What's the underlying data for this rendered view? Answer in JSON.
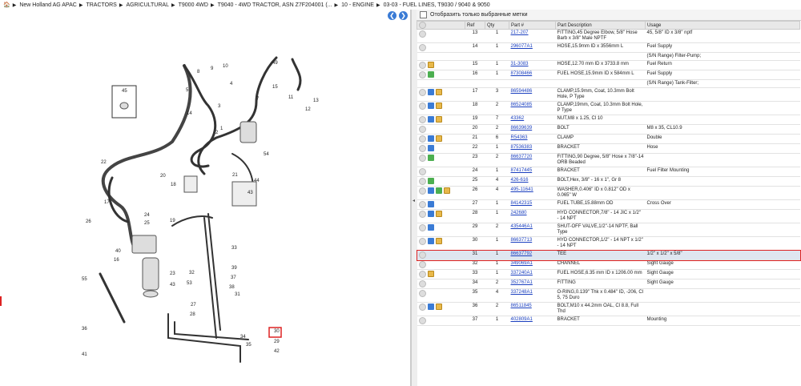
{
  "breadcrumbs": [
    "New Holland AG APAC",
    "TRACTORS",
    "AGRICULTURAL",
    "T9000 4WD",
    "T9040 - 4WD TRACTOR, ASN Z7F204001 (...",
    "10 - ENGINE",
    "03-03 - FUEL LINES, T9030 / 9040 & 9050"
  ],
  "filter": {
    "label": "Отобразить только выбранные метки"
  },
  "table": {
    "headers": {
      "ref": "Ref",
      "qty": "Qty",
      "part": "Part #",
      "desc": "Part Description",
      "usage": "Usage"
    },
    "rows": [
      {
        "ref": "13",
        "qty": "1",
        "part": "217-207",
        "desc": "FITTING,45 Degree Elbow, 5/8\" Hose Barb x 3/8\" Male NPTF",
        "usage": "45, 5/8\" ID x 3/8\" nptf",
        "icons": []
      },
      {
        "ref": "14",
        "qty": "1",
        "part": "296077A1",
        "desc": "HOSE,15.9mm ID x 3556mm L",
        "usage": "Fuel Supply",
        "icons": []
      },
      {
        "ref": "",
        "qty": "",
        "part": "",
        "desc": "",
        "usage": "(S/N Range) Filter-Pump;",
        "icons": []
      },
      {
        "ref": "15",
        "qty": "1",
        "part": "31-3083",
        "desc": "HOSE,12.70 mm ID x 3733.8 mm",
        "usage": "Fuel Return",
        "icons": [
          "bx"
        ]
      },
      {
        "ref": "16",
        "qty": "1",
        "part": "87308466",
        "desc": "FUEL HOSE,15.9mm ID x 584mm L",
        "usage": "Fuel Supply",
        "icons": [
          "gr"
        ]
      },
      {
        "ref": "",
        "qty": "",
        "part": "",
        "desc": "",
        "usage": "(S/N Range) Tank-Filter;",
        "icons": []
      },
      {
        "ref": "17",
        "qty": "3",
        "part": "86594486",
        "desc": "CLAMP,15.9mm, Coat, 10.3mm Bolt Hole, P Type",
        "usage": "",
        "icons": [
          "sw",
          "bx"
        ]
      },
      {
        "ref": "18",
        "qty": "2",
        "part": "86524085",
        "desc": "CLAMP,19mm, Coat, 10.3mm Bolt Hole, P Type",
        "usage": "",
        "icons": [
          "sw",
          "bx"
        ]
      },
      {
        "ref": "19",
        "qty": "7",
        "part": "43362",
        "desc": "NUT,M8 x 1.25, Cl 10",
        "usage": "",
        "icons": [
          "sw",
          "bx"
        ]
      },
      {
        "ref": "20",
        "qty": "2",
        "part": "86639639",
        "desc": "BOLT",
        "usage": "M8 x 35, CL10.9",
        "icons": []
      },
      {
        "ref": "21",
        "qty": "6",
        "part": "R54363",
        "desc": "CLAMP",
        "usage": "Double",
        "icons": [
          "sw",
          "bx"
        ]
      },
      {
        "ref": "22",
        "qty": "1",
        "part": "87536383",
        "desc": "BRACKET",
        "usage": "Hose",
        "icons": [
          "sw"
        ]
      },
      {
        "ref": "23",
        "qty": "2",
        "part": "86637720",
        "desc": "FITTING,90 Degree, 5/8\" Hose x 7/8\"-14 ORB Beaded",
        "usage": "",
        "icons": [
          "gr"
        ]
      },
      {
        "ref": "24",
        "qty": "1",
        "part": "87417445",
        "desc": "BRACKET",
        "usage": "Fuel Filter Mounting",
        "icons": []
      },
      {
        "ref": "25",
        "qty": "4",
        "part": "426-616",
        "desc": "BOLT,Hex, 3/8\" - 16 x 1\", Gr 8",
        "usage": "",
        "icons": [
          "gr"
        ]
      },
      {
        "ref": "26",
        "qty": "4",
        "part": "495-11641",
        "desc": "WASHER,0.406\" ID x 0.812\" OD x 0.065\" W",
        "usage": "",
        "icons": [
          "sw",
          "gr",
          "bx"
        ]
      },
      {
        "ref": "27",
        "qty": "1",
        "part": "84142315",
        "desc": "FUEL TUBE,15.88mm OD",
        "usage": "Cross Over",
        "icons": [
          "sw"
        ]
      },
      {
        "ref": "28",
        "qty": "1",
        "part": "242680",
        "desc": "HYD CONNECTOR,7/8\" - 14 JIC x 1/2\" - 14 NPT",
        "usage": "",
        "icons": [
          "sw",
          "bx"
        ]
      },
      {
        "ref": "29",
        "qty": "2",
        "part": "435446A1",
        "desc": "SHUT-OFF VALVE,1/2\"-14 NPTF, Ball Type",
        "usage": "",
        "icons": [
          "sw"
        ]
      },
      {
        "ref": "30",
        "qty": "1",
        "part": "86637713",
        "desc": "HYD CONNECTOR,1/2\" - 14 NPT x 1/2\" - 14 NPT",
        "usage": "",
        "icons": [
          "sw",
          "bx"
        ]
      },
      {
        "ref": "31",
        "qty": "1",
        "part": "86637792",
        "desc": "TEE",
        "usage": "1/2\" x 1/2\" x 5/8\"",
        "icons": [],
        "selected": true
      },
      {
        "ref": "32",
        "qty": "1",
        "part": "349069A1",
        "desc": "CHANNEL",
        "usage": "Sight Gauge",
        "icons": []
      },
      {
        "ref": "33",
        "qty": "1",
        "part": "337240A1",
        "desc": "FUEL HOSE,6.35 mm ID x 1206.00 mm",
        "usage": "Sight Gauge",
        "icons": [
          "bx"
        ]
      },
      {
        "ref": "34",
        "qty": "2",
        "part": "352767A1",
        "desc": "FITTING",
        "usage": "Sight Gauge",
        "icons": []
      },
      {
        "ref": "35",
        "qty": "4",
        "part": "337248A1",
        "desc": "O-RING,0.139\" Thk x 0.484\" ID, -206, Cl 5, 75 Duro",
        "usage": "",
        "icons": []
      },
      {
        "ref": "36",
        "qty": "2",
        "part": "86511845",
        "desc": "BOLT,M10 x 44.2mm OAL, Cl 8.8, Full Thd",
        "usage": "",
        "icons": [
          "sw",
          "bx"
        ]
      },
      {
        "ref": "37",
        "qty": "1",
        "part": "402809A1",
        "desc": "BRACKET",
        "usage": "Mounting",
        "icons": []
      }
    ]
  },
  "diagram": {
    "callouts": [
      "45",
      "10",
      "9",
      "8",
      "5",
      "49",
      "15",
      "14",
      "4",
      "12",
      "13",
      "7",
      "11",
      "54",
      "2",
      "3",
      "1",
      "21",
      "22",
      "17",
      "20",
      "18",
      "19",
      "44",
      "43",
      "24",
      "25",
      "26",
      "40",
      "16",
      "55",
      "23",
      "43",
      "53",
      "27",
      "28",
      "32",
      "33",
      "39",
      "36",
      "41",
      "42",
      "29",
      "30",
      "31",
      "37",
      "38",
      "34",
      "35"
    ],
    "highlight": "31"
  }
}
